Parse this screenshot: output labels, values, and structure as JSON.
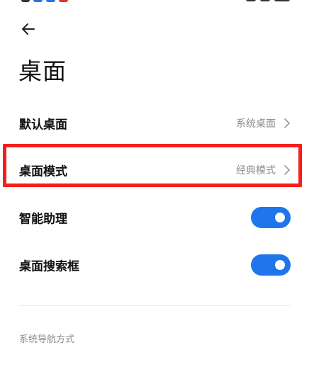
{
  "header": {
    "back_icon": "arrow-left-icon",
    "title": "桌面"
  },
  "settings": [
    {
      "label": "默认桌面",
      "value": "系统桌面",
      "control": "chevron"
    },
    {
      "label": "桌面模式",
      "value": "经典模式",
      "control": "chevron",
      "highlighted": true
    },
    {
      "label": "智能助理",
      "control": "toggle",
      "on": true
    },
    {
      "label": "桌面搜索框",
      "control": "toggle",
      "on": true
    }
  ],
  "section": {
    "title": "系统导航方式"
  },
  "colors": {
    "toggle_on": "#1f75ec",
    "highlight_border": "#f5201c",
    "secondary_text": "#8c8c8c",
    "status_icon_blue": "#2f6fe6",
    "status_icon_red": "#e53030"
  }
}
